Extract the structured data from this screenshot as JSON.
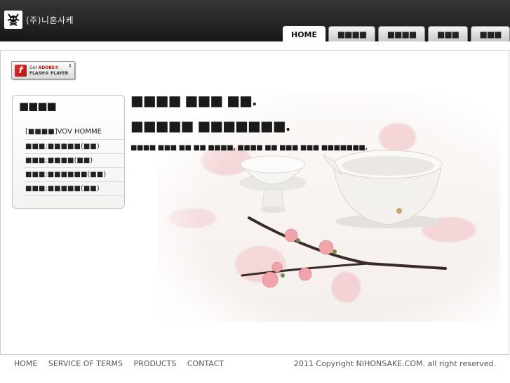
{
  "header": {
    "logo_text": "(주)니혼사케",
    "tabs": [
      {
        "label": "HOME",
        "active": true
      },
      {
        "label": "■■■■",
        "active": false
      },
      {
        "label": "■■■■",
        "active": false
      },
      {
        "label": "■■■",
        "active": false
      },
      {
        "label": "■■■",
        "active": false
      }
    ]
  },
  "flash": {
    "line1_prefix": "Get ",
    "line1_brand": "ADOBE®",
    "line2": "FLASH® PLAYER"
  },
  "sidebox": {
    "title": "■■■■",
    "items": [
      "[■■■■]VOV HOMME",
      "■■■;■■■■■(■■)",
      "■■■;■■■■(■■)",
      "■■■;■■■■■■(■■)",
      "■■■;■■■■■(■■)"
    ]
  },
  "hero": {
    "headline_1": "■■■■ ■■■ ■■.",
    "headline_2": "■■■■■ ■■■■■■■.",
    "subline": "■■■■ ■■■ ■■ ■■ ■■■■, ■■■■ ■■ ■■■ ■■■ ■■■■■■■."
  },
  "footer": {
    "links": [
      "HOME",
      "SERVICE OF TERMS",
      "PRODUCTS",
      "CONTACT"
    ],
    "copyright": "2011 Copyright NIHONSAKE.COM. all right reserved."
  },
  "colors": {
    "header_bg": "#2a2a2a",
    "blossom_pink": "#f0bec3",
    "flash_red": "#c01d16"
  }
}
